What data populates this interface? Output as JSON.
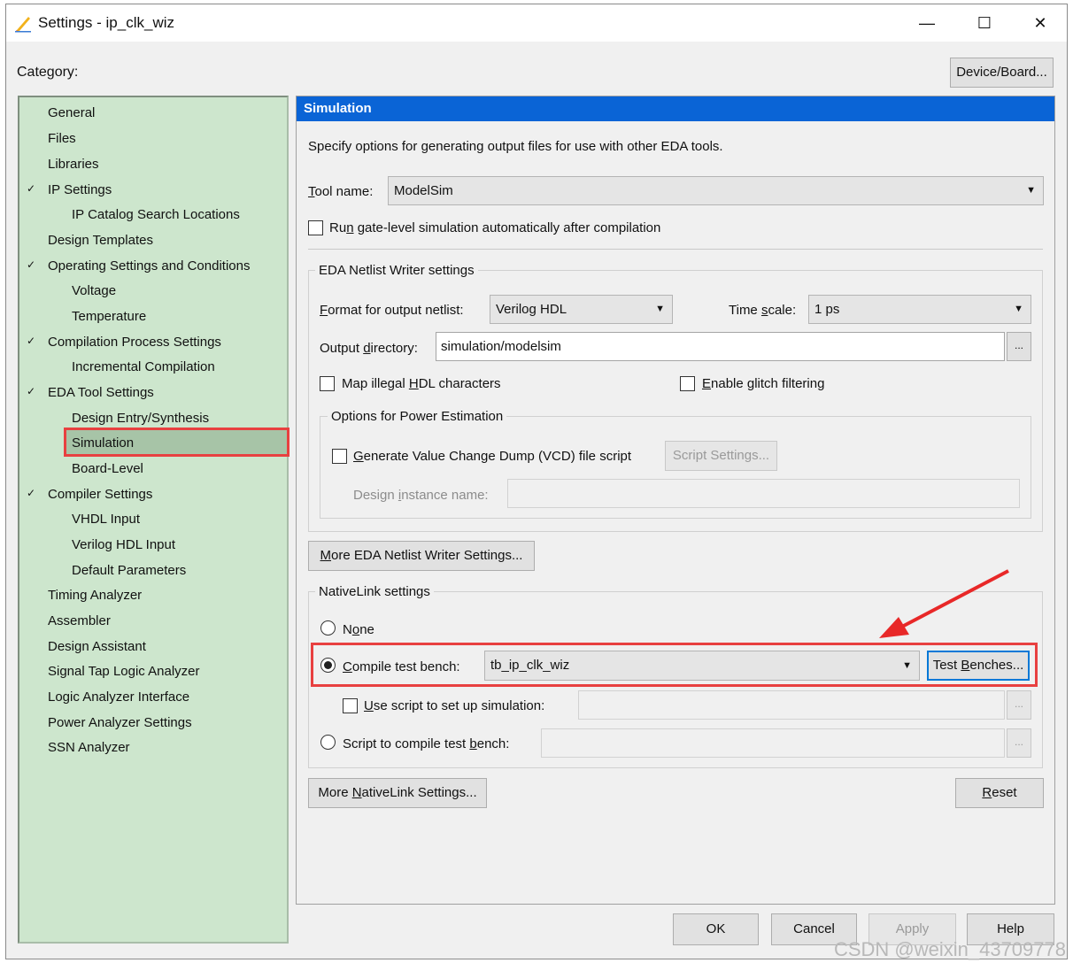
{
  "window": {
    "title": "Settings - ip_clk_wiz",
    "controls": {
      "minimize": "—",
      "maximize": "☐",
      "close": "✕"
    }
  },
  "category_label": "Category:",
  "device_board_button": "Device/Board...",
  "tree": {
    "items": [
      {
        "label": "General"
      },
      {
        "label": "Files"
      },
      {
        "label": "Libraries"
      },
      {
        "label": "IP Settings"
      },
      {
        "label": "IP Catalog Search Locations"
      },
      {
        "label": "Design Templates"
      },
      {
        "label": "Operating Settings and Conditions"
      },
      {
        "label": "Voltage"
      },
      {
        "label": "Temperature"
      },
      {
        "label": "Compilation Process Settings"
      },
      {
        "label": "Incremental Compilation"
      },
      {
        "label": "EDA Tool Settings"
      },
      {
        "label": "Design Entry/Synthesis"
      },
      {
        "label": "Simulation"
      },
      {
        "label": "Board-Level"
      },
      {
        "label": "Compiler Settings"
      },
      {
        "label": "VHDL Input"
      },
      {
        "label": "Verilog HDL Input"
      },
      {
        "label": "Default Parameters"
      },
      {
        "label": "Timing Analyzer"
      },
      {
        "label": "Assembler"
      },
      {
        "label": "Design Assistant"
      },
      {
        "label": "Signal Tap Logic Analyzer"
      },
      {
        "label": "Logic Analyzer Interface"
      },
      {
        "label": "Power Analyzer Settings"
      },
      {
        "label": "SSN Analyzer"
      }
    ],
    "selected": "Simulation"
  },
  "panel": {
    "header": "Simulation",
    "description": "Specify options for generating output files for use with other EDA tools.",
    "tool_name": {
      "label_u": "T",
      "label_rest": "ool name:",
      "value": "ModelSim"
    },
    "run_gate_level": {
      "pre": "Ru",
      "u": "n",
      "post": " gate-level simulation automatically after compilation",
      "checked": false
    },
    "eda_netlist": {
      "legend": "EDA Netlist Writer settings",
      "format_label_u": "F",
      "format_label_rest": "ormat for output netlist:",
      "format_value": "Verilog HDL",
      "timescale_pre": "Time ",
      "timescale_u": "s",
      "timescale_post": "cale:",
      "timescale_value": "1 ps",
      "output_dir_pre": "Output ",
      "output_dir_u": "d",
      "output_dir_post": "irectory:",
      "output_dir_value": "simulation/modelsim",
      "browse": "...",
      "map_illegal_pre": "Map illegal ",
      "map_illegal_u": "H",
      "map_illegal_post": "DL characters",
      "glitch_u": "E",
      "glitch_rest": "nable glitch filtering",
      "power": {
        "legend": "Options for Power Estimation",
        "vcd_u": "G",
        "vcd_rest": "enerate Value Change Dump (VCD) file script",
        "script_settings": "Script Settings...",
        "instance_pre": "Design ",
        "instance_u": "i",
        "instance_post": "nstance name:",
        "instance_value": ""
      }
    },
    "more_eda_u": "M",
    "more_eda_rest": "ore EDA Netlist Writer Settings...",
    "nativelink": {
      "legend": "NativeLink settings",
      "none_pre": "N",
      "none_u": "o",
      "none_post": "ne",
      "compile_u": "C",
      "compile_rest": "ompile test bench:",
      "compile_value": "tb_ip_clk_wiz",
      "test_benches_pre": "Test ",
      "test_benches_u": "B",
      "test_benches_post": "enches...",
      "use_script_u": "U",
      "use_script_rest": "se script to set up simulation:",
      "script_compile_pre": "Script to compile test ",
      "script_compile_u": "b",
      "script_compile_post": "ench:",
      "selected": "compile"
    },
    "more_nativelink_pre": "More ",
    "more_nativelink_u": "N",
    "more_nativelink_post": "ativeLink Settings...",
    "reset_u": "R",
    "reset_rest": "eset"
  },
  "footer": {
    "ok": "OK",
    "cancel": "Cancel",
    "apply": "Apply",
    "help": "Help"
  },
  "watermark": "CSDN @weixin_43709778",
  "colors": {
    "tree_bg": "#cde6cd",
    "header_bg": "#0a64d6",
    "highlight": "#e84040",
    "focus": "#0078d7"
  }
}
